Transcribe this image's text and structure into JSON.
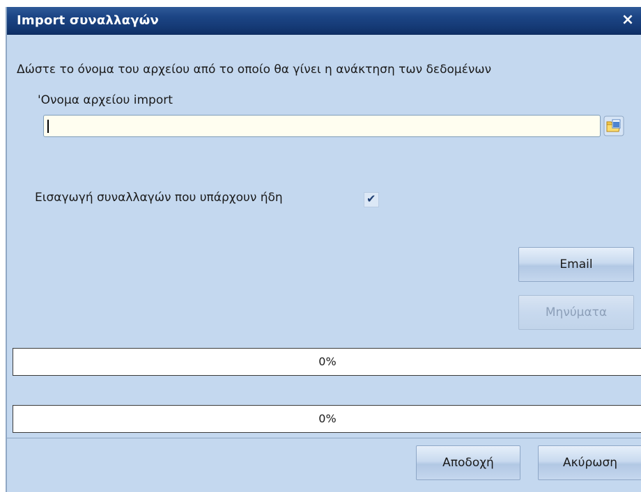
{
  "window": {
    "title": "Import συναλλαγών",
    "close_glyph": "×"
  },
  "form": {
    "instruction": "Δώστε το όνομα του αρχείου από το οποίο θα γίνει η ανάκτηση των δεδομένων",
    "file_label": "'Ονομα αρχείου import",
    "file_value": "",
    "browse_icon": "folder-browse-icon",
    "checkbox_label": "Εισαγωγή συναλλαγών που υπάρχουν ήδη",
    "checkbox_checked": true,
    "checkbox_mark": "✔"
  },
  "actions": {
    "email_label": "Email",
    "messages_label": "Μηνύματα"
  },
  "progress": [
    {
      "value": 0,
      "text": "0%"
    },
    {
      "value": 0,
      "text": "0%"
    }
  ],
  "footer": {
    "accept_label": "Αποδοχή",
    "cancel_label": "Ακύρωση"
  },
  "colors": {
    "dialog_bg": "#c4d8ef",
    "title_bg": "#1c4585",
    "progress_fill": "#2f6ec7"
  }
}
